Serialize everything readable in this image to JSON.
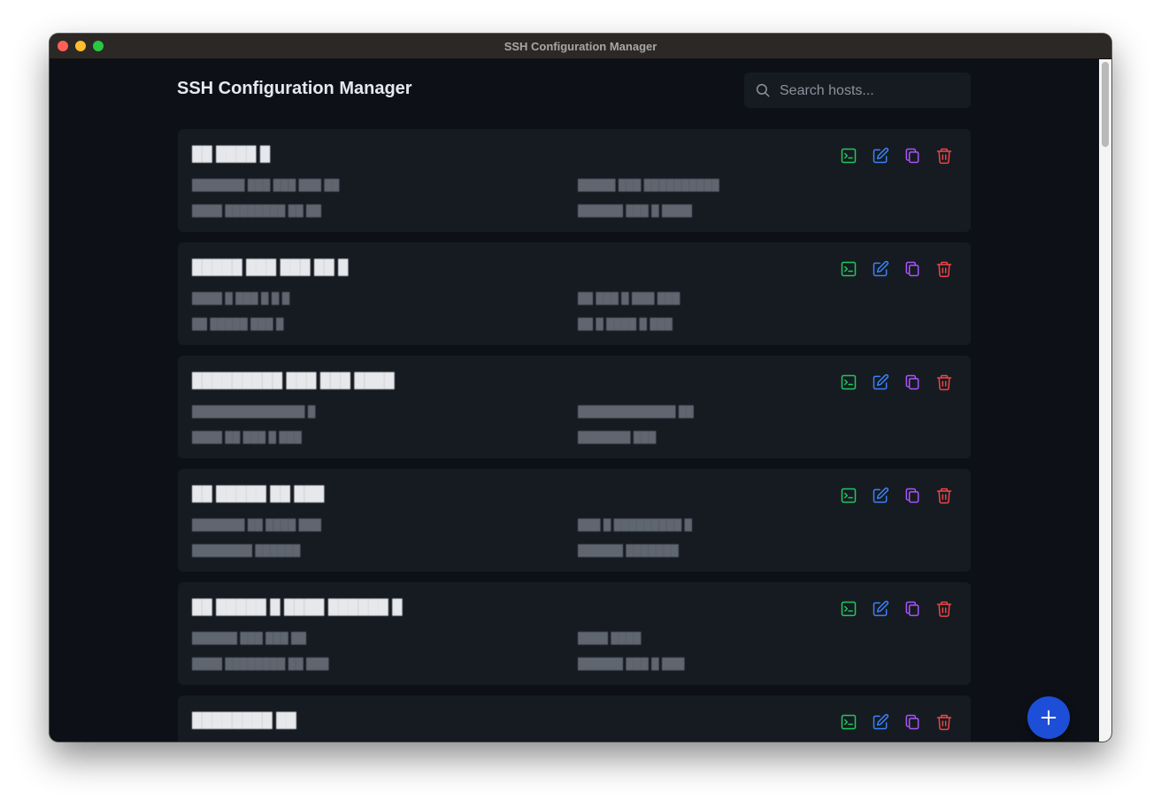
{
  "window": {
    "title": "SSH Configuration Manager"
  },
  "header": {
    "title": "SSH Configuration Manager",
    "search_placeholder": "Search hosts..."
  },
  "colors": {
    "background": "#0d1117",
    "card": "#161b22",
    "connect": "#22c55e",
    "edit": "#3b82f6",
    "copy": "#a855f7",
    "delete": "#ef4444",
    "fab": "#1d4ed8"
  },
  "hosts": [
    {
      "name": "██ ████ █",
      "user": "███████  ███ ███ ███ ██",
      "host": "█████ ███  ██████████",
      "port": "████ ████████ ██ ██",
      "key": "██████ ███ █ ████"
    },
    {
      "name": "█████ ███ ███ ██ █",
      "user": "████ █ ███ █ █ █",
      "host": "██    ███ █ ███ ███",
      "port": "██ █████   ███ █",
      "key": "██ █ ████ █ ███"
    },
    {
      "name": "█████████ ███  ███ ████",
      "user": "███████████████ █",
      "host": "█████████████ ██",
      "port": "████ ██ ███ █ ███",
      "key": "███████ ███"
    },
    {
      "name": "██ █████ ██  ███",
      "user": "███████ ██ ████ ███",
      "host": "███ █ █████████ █",
      "port": "████████ ██████",
      "key": "██████ ███████"
    },
    {
      "name": "██ █████ █ ████ ██████ █",
      "user": "██████  ███ ███ ██",
      "host": "████ ████",
      "port": "████ ████████ ██ ███",
      "key": "██████ ███ █ ███"
    },
    {
      "name": "████████ ██",
      "user": "",
      "host": "",
      "port": "",
      "key": ""
    }
  ],
  "icons": {
    "connect": "terminal-icon",
    "edit": "edit-icon",
    "copy": "copy-icon",
    "delete": "trash-icon",
    "add": "plus-icon",
    "search": "search-icon"
  }
}
